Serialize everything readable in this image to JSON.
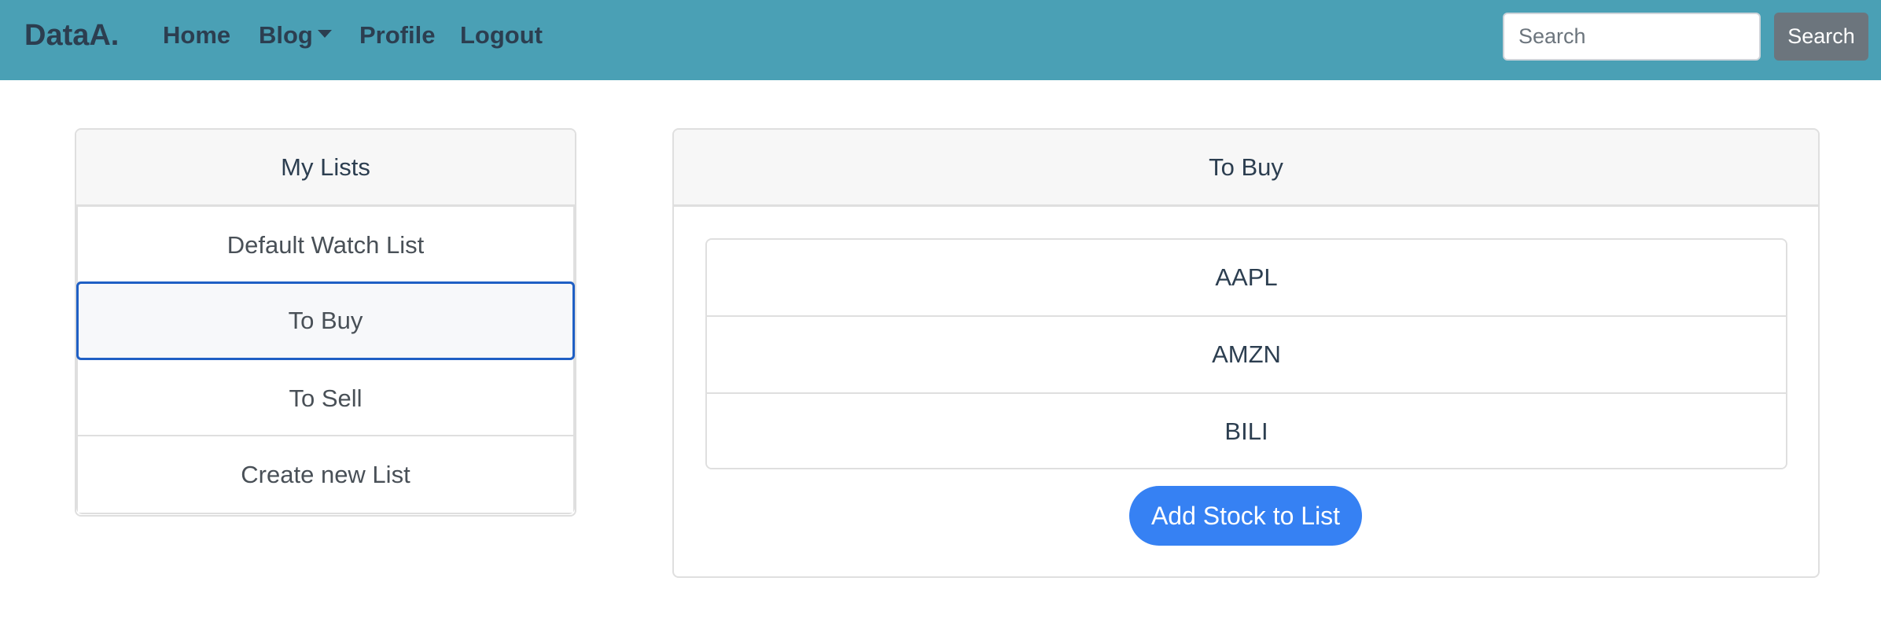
{
  "navbar": {
    "brand": "DataA.",
    "links": [
      {
        "label": "Home"
      },
      {
        "label": "Blog",
        "has_dropdown": true
      },
      {
        "label": "Profile"
      },
      {
        "label": "Logout"
      }
    ],
    "search": {
      "placeholder": "Search",
      "value": "",
      "button_label": "Search"
    }
  },
  "lists_panel": {
    "title": "My Lists",
    "items": [
      {
        "label": "Default Watch List",
        "active": false
      },
      {
        "label": "To Buy",
        "active": true
      },
      {
        "label": "To Sell",
        "active": false
      },
      {
        "label": "Create new List",
        "active": false
      }
    ]
  },
  "detail_panel": {
    "title": "To Buy",
    "stocks": [
      {
        "symbol": "AAPL"
      },
      {
        "symbol": "AMZN"
      },
      {
        "symbol": "BILI"
      }
    ],
    "add_button_label": "Add Stock to List"
  },
  "colors": {
    "navbar_bg": "#4aa0b5",
    "text_primary": "#2c3e50",
    "active_border": "#1f5fc4",
    "primary_button": "#3681f3",
    "secondary_button": "#6c757d"
  }
}
